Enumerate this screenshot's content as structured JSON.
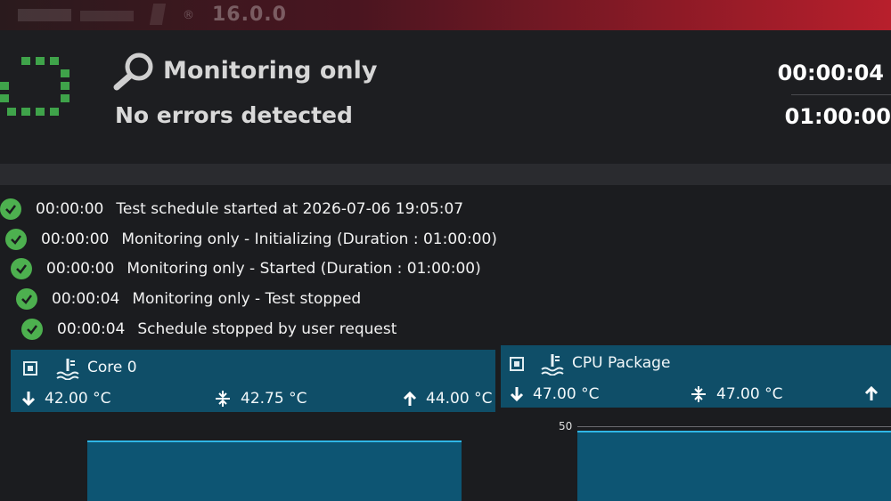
{
  "app": {
    "version": "16.0.0"
  },
  "header": {
    "mode_title": "Monitoring only",
    "error_status": "No errors detected",
    "elapsed_time": "00:00:04",
    "duration": "01:00:00"
  },
  "log": [
    {
      "time": "00:00:00",
      "message": "Test schedule started at 2026-07-06 19:05:07"
    },
    {
      "time": "00:00:00",
      "message": "Monitoring only - Initializing (Duration : 01:00:00)"
    },
    {
      "time": "00:00:00",
      "message": "Monitoring only - Started (Duration : 01:00:00)"
    },
    {
      "time": "00:00:04",
      "message": "Monitoring only - Test stopped"
    },
    {
      "time": "00:00:04",
      "message": "Schedule stopped by user request"
    }
  ],
  "sensors": [
    {
      "name": "Core 0",
      "min": "42.00 °C",
      "avg": "42.75 °C",
      "max": "44.00 °C"
    },
    {
      "name": "CPU Package",
      "min": "47.00 °C",
      "avg": "47.00 °C"
    }
  ],
  "graph": {
    "axis_max_label": "50"
  },
  "colors": {
    "accent": "#0f4e68",
    "ok": "#4db04f",
    "topbar": "#b81f2c",
    "graph_line": "#2fb6e6"
  }
}
